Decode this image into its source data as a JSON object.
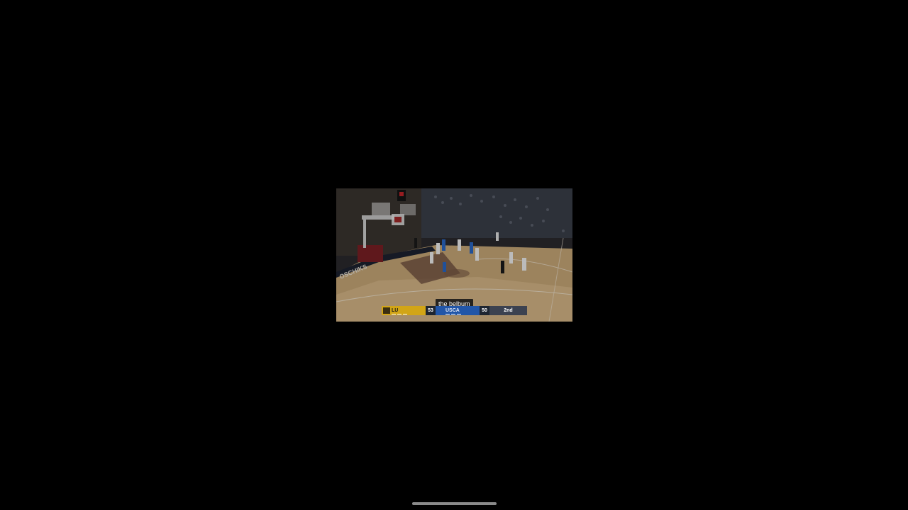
{
  "video": {
    "caption": "the belbum",
    "scorebug": {
      "home_team": "LU",
      "home_score": "53",
      "away_team": "USCA",
      "away_score": "50",
      "period": "2nd",
      "home_color": "#d2a516",
      "away_color": "#2256a8"
    },
    "court_text": "OSCHIKS"
  },
  "system": {
    "home_indicator": "home-bar"
  }
}
